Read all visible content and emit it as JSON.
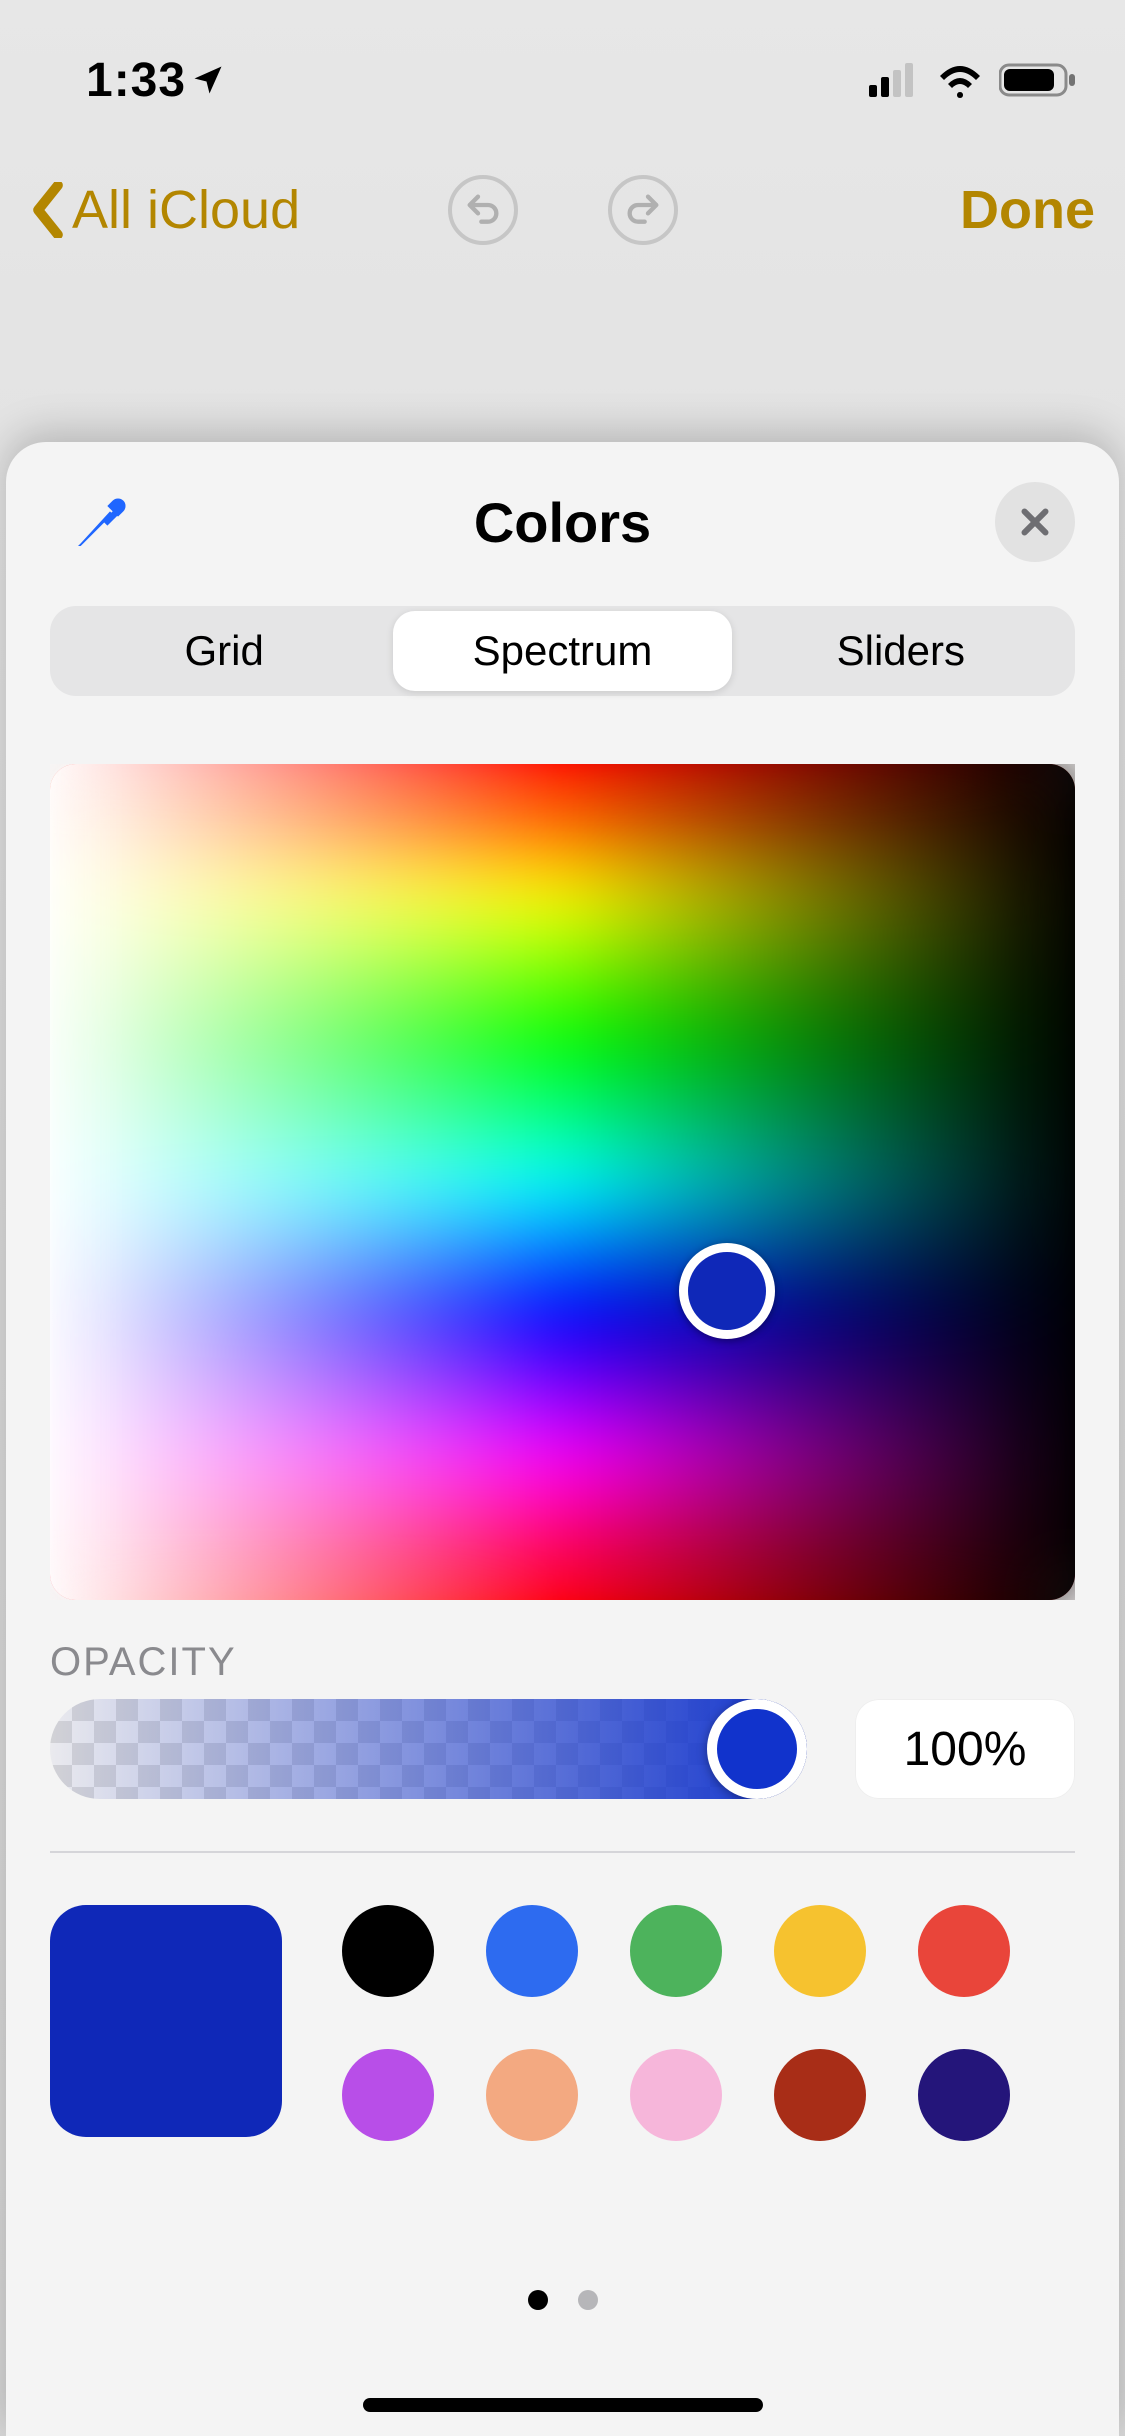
{
  "status": {
    "time": "1:33"
  },
  "nav": {
    "back_label": "All iCloud",
    "done_label": "Done",
    "accent": "#b38600"
  },
  "sheet": {
    "title": "Colors",
    "tabs": [
      "Grid",
      "Spectrum",
      "Sliders"
    ],
    "selected_tab": 1
  },
  "spectrum": {
    "loupe_left_pct": 66,
    "loupe_top_pct": 63
  },
  "opacity": {
    "label": "OPACITY",
    "value_pct": 100,
    "readout": "100%",
    "tint": "#1133cc"
  },
  "current_color": "#0f28b8",
  "swatches": {
    "row1": [
      "#000000",
      "#2d6bf0",
      "#4db35c",
      "#f6c22f",
      "#e9453a"
    ],
    "row2": [
      "#b84ee8",
      "#f3a981",
      "#f6b6da",
      "#a82d17",
      "#24157a"
    ]
  },
  "pager": {
    "count": 2,
    "index": 0
  }
}
